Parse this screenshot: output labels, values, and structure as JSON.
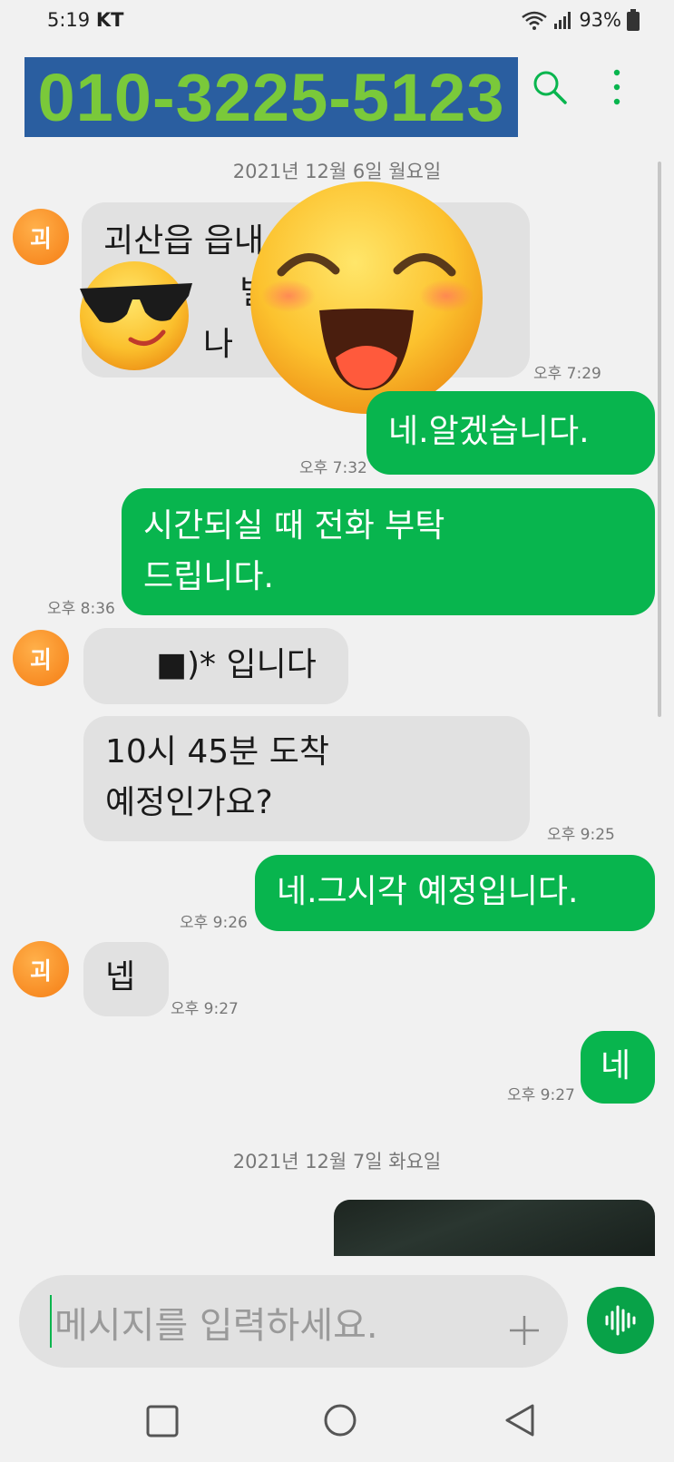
{
  "status": {
    "time": "5:19",
    "carrier": "KT",
    "battery": "93%"
  },
  "header": {
    "title": "010-3225-5123"
  },
  "conversation": {
    "date1": "2021년 12월 6일 월요일",
    "date2": "2021년 12월 7일 화요일",
    "avatar_letter": "괴",
    "msg1": {
      "line1": "괴산읍 읍내",
      "line2": "빌딩",
      "line3": "나",
      "time": "오후 7:29"
    },
    "msg2": {
      "text": "네.알겠습니다.",
      "time": "오후 7:32"
    },
    "msg3": {
      "line1": "시간되실 때 전화 부탁",
      "line2": "드립니다.",
      "time": "오후 8:36"
    },
    "msg4": {
      "text": "■)* 입니다"
    },
    "msg5": {
      "line1": "10시 45분 도착",
      "line2": "예정인가요?",
      "time": "오후 9:25"
    },
    "msg6": {
      "text": "네.그시각 예정입니다.",
      "time": "오후 9:26"
    },
    "msg7": {
      "text": "넵",
      "time": "오후 9:27"
    },
    "msg8": {
      "text": "네",
      "time": "오후 9:27"
    }
  },
  "input": {
    "placeholder": "메시지를 입력하세요."
  },
  "colors": {
    "sent_bubble": "#08b54e",
    "received_bubble": "#e1e1e1",
    "avatar": "#f57d14",
    "title_bg": "#2a5ea0",
    "title_text": "#7ac93a"
  }
}
